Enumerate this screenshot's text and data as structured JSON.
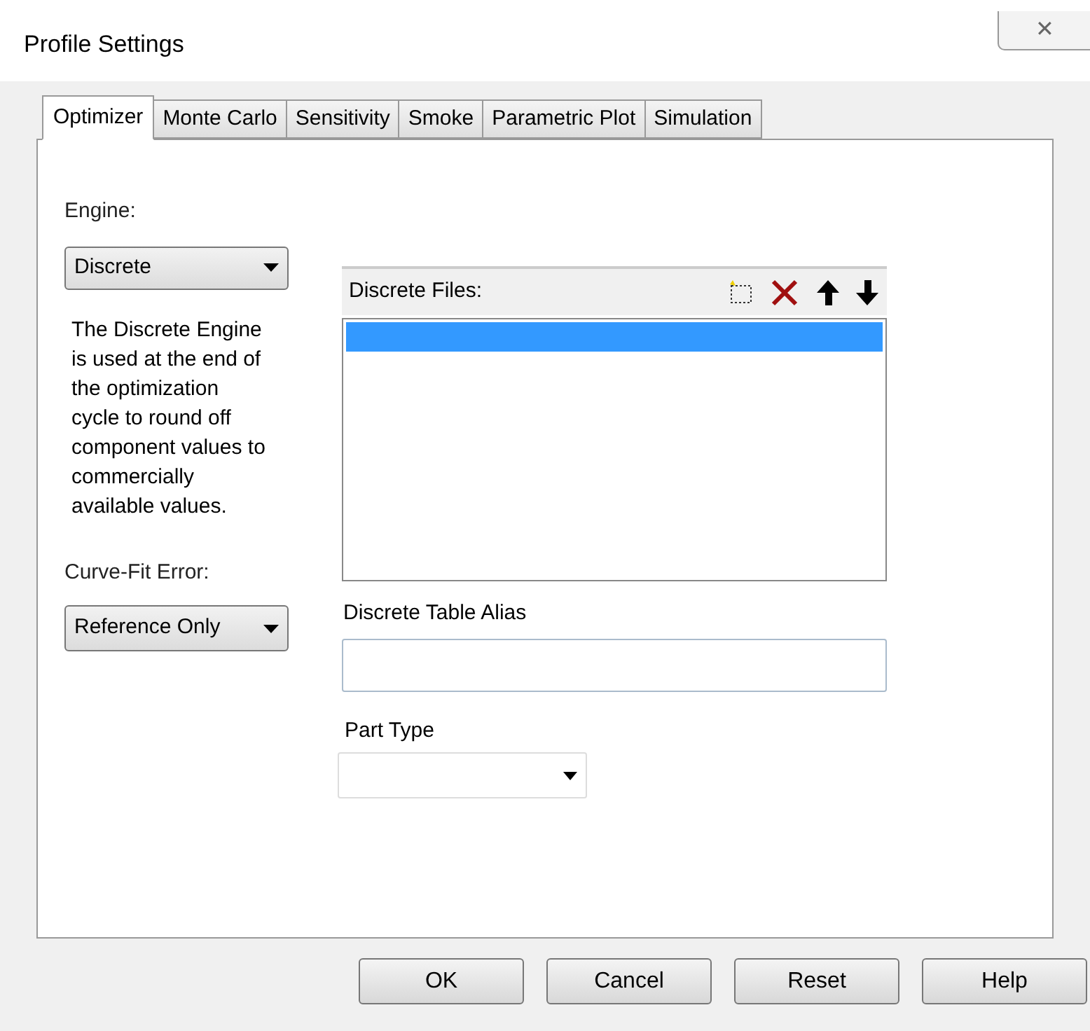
{
  "window": {
    "title": "Profile Settings",
    "close": "✕"
  },
  "tabs": [
    {
      "label": "Optimizer",
      "selected": true
    },
    {
      "label": "Monte Carlo",
      "selected": false
    },
    {
      "label": "Sensitivity",
      "selected": false
    },
    {
      "label": "Smoke",
      "selected": false
    },
    {
      "label": "Parametric Plot",
      "selected": false
    },
    {
      "label": "Simulation",
      "selected": false
    }
  ],
  "engine": {
    "label": "Engine:",
    "value": "Discrete"
  },
  "description": "The Discrete Engine is used at the end of the optimization cycle to round off component values to commercially available values.",
  "curve_fit_error": {
    "label": "Curve-Fit Error:",
    "value": "Reference Only"
  },
  "discrete_files": {
    "label": "Discrete Files:",
    "rows": [
      {
        "selected": true
      }
    ]
  },
  "discrete_table_alias": {
    "label": "Discrete Table Alias"
  },
  "part_type": {
    "label": "Part Type"
  },
  "buttons": [
    "OK",
    "Cancel",
    "Reset",
    "Help"
  ]
}
